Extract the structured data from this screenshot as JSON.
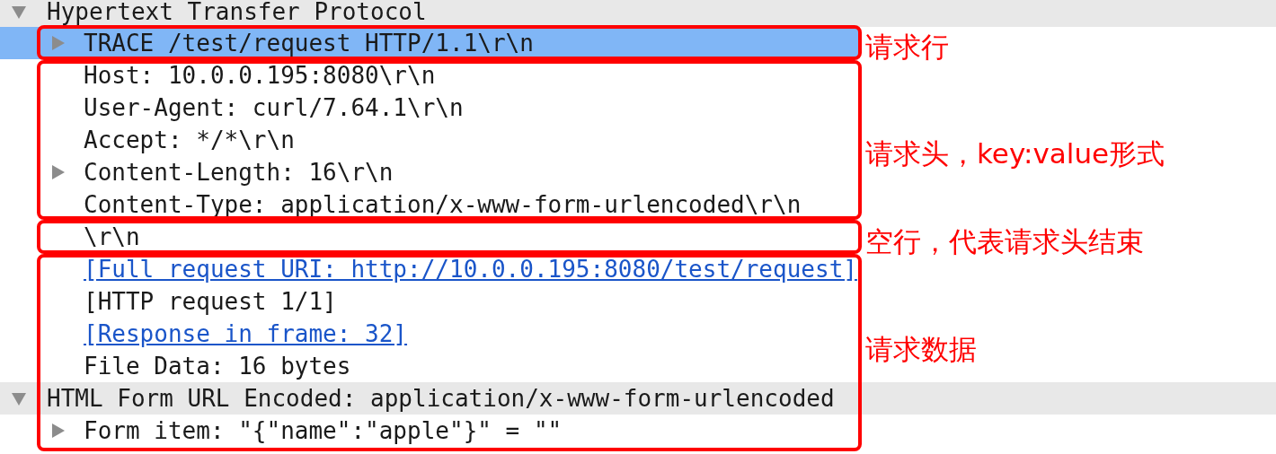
{
  "protocol_tree": [
    {
      "label": "Hypertext Transfer Protocol",
      "expanded": true,
      "selected": false,
      "children": [
        {
          "label": "TRACE /test/request HTTP/1.1\\r\\n",
          "expanded": false,
          "selected": true
        },
        {
          "label": "Host: 10.0.0.195:8080\\r\\n",
          "selected": false
        },
        {
          "label": "User-Agent: curl/7.64.1\\r\\n",
          "selected": false
        },
        {
          "label": "Accept: */*\\r\\n",
          "selected": false
        },
        {
          "label": "Content-Length: 16\\r\\n",
          "expanded": false,
          "selected": false
        },
        {
          "label": "Content-Type: application/x-www-form-urlencoded\\r\\n",
          "selected": false
        },
        {
          "label": "\\r\\n",
          "selected": false
        },
        {
          "label": "[Full request URI: http://10.0.0.195:8080/test/request]",
          "kind": "link",
          "selected": false
        },
        {
          "label": "[HTTP request 1/1]",
          "selected": false
        },
        {
          "label": "[Response in frame: 32]",
          "kind": "link",
          "selected": false
        },
        {
          "label": "File Data: 16 bytes",
          "selected": false
        }
      ]
    },
    {
      "label": "HTML Form URL Encoded: application/x-www-form-urlencoded",
      "expanded": true,
      "selected": false,
      "children": [
        {
          "label": "Form item: \"{\"name\":\"apple\"}\" = \"\"",
          "expanded": false,
          "selected": false
        }
      ]
    }
  ],
  "annotations": [
    {
      "label": "请求行"
    },
    {
      "label": "请求头，key:value形式"
    },
    {
      "label": "空行，代表请求头结束"
    },
    {
      "label": "请求数据"
    }
  ]
}
